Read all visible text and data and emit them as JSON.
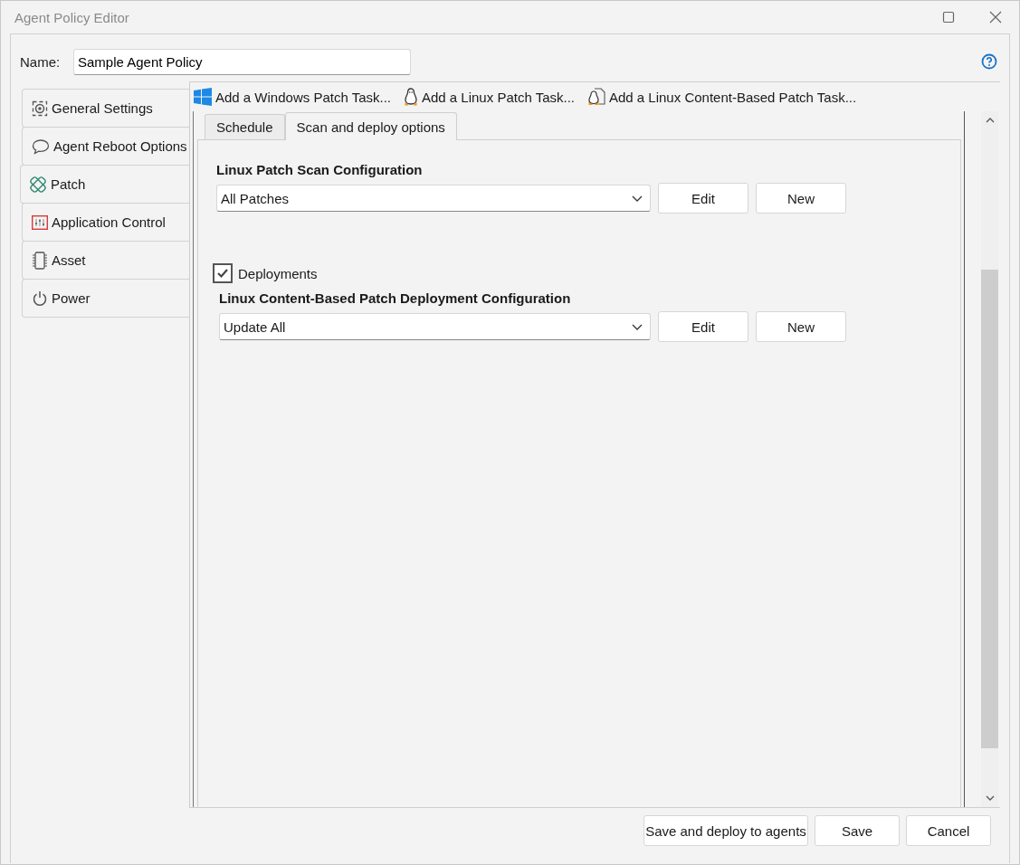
{
  "window": {
    "title": "Agent Policy Editor"
  },
  "name_field": {
    "label": "Name:",
    "value": "Sample Agent Policy"
  },
  "nav": [
    {
      "label": "General Settings",
      "kind": "gear",
      "selected": false
    },
    {
      "label": "Agent Reboot Options",
      "kind": "bubble",
      "selected": false
    },
    {
      "label": "Patch",
      "kind": "bandage",
      "selected": true
    },
    {
      "label": "Application Control",
      "kind": "sliders",
      "selected": false
    },
    {
      "label": "Asset",
      "kind": "chip",
      "selected": false
    },
    {
      "label": "Power",
      "kind": "power",
      "selected": false
    }
  ],
  "toolbar": [
    {
      "label": "Add a Windows Patch Task...",
      "kind": "windows"
    },
    {
      "label": "Add a Linux Patch Task...",
      "kind": "penguin"
    },
    {
      "label": "Add a Linux Content-Based Patch Task...",
      "kind": "penguin-doc"
    }
  ],
  "tabs": [
    {
      "label": "Schedule",
      "selected": false
    },
    {
      "label": "Scan and deploy options",
      "selected": true
    }
  ],
  "scan": {
    "heading": "Linux Patch Scan Configuration",
    "value": "All Patches",
    "buttons": [
      "Edit",
      "New"
    ]
  },
  "deployments": {
    "label": "Deployments",
    "checked": true
  },
  "deploy_config": {
    "heading": "Linux Content-Based Patch Deployment Configuration",
    "value": "Update All",
    "buttons": [
      "Edit",
      "New"
    ]
  },
  "footer_buttons": [
    "Save and deploy to agents",
    "Save",
    "Cancel"
  ]
}
